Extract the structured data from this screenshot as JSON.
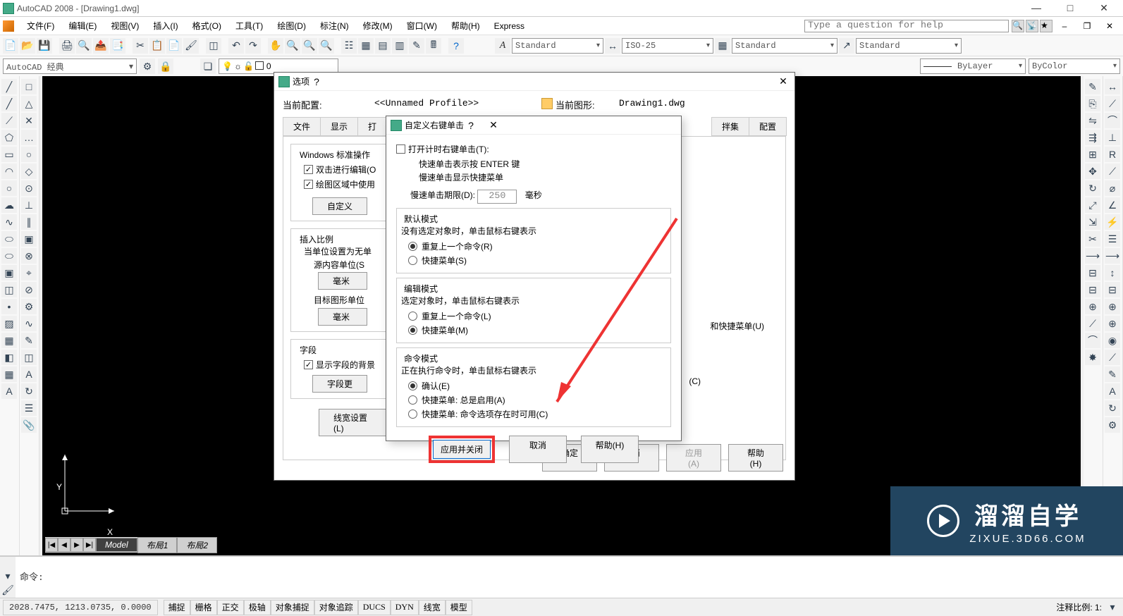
{
  "titlebar": {
    "app": "AutoCAD 2008",
    "doc": "[Drawing1.dwg]"
  },
  "winControls": {
    "min": "—",
    "max": "□",
    "close": "✕"
  },
  "menu": {
    "items": [
      "文件(F)",
      "编辑(E)",
      "视图(V)",
      "插入(I)",
      "格式(O)",
      "工具(T)",
      "绘图(D)",
      "标注(N)",
      "修改(M)",
      "窗口(W)",
      "帮助(H)",
      "Express"
    ],
    "helpPlaceholder": "Type a question for help"
  },
  "styleCombos": {
    "text": "Standard",
    "dim": "ISO-25",
    "table": "Standard",
    "ml": "Standard"
  },
  "workspace": "AutoCAD 经典",
  "properties": {
    "layer": "0",
    "linetype": "ByLayer",
    "color": "ByColor"
  },
  "layoutTabs": {
    "nav": [
      "|◀",
      "◀",
      "▶",
      "▶|"
    ],
    "model": "Model",
    "l1": "布局1",
    "l2": "布局2"
  },
  "ucs": {
    "x": "X",
    "y": "Y"
  },
  "command": {
    "prompt": "命令:"
  },
  "status": {
    "coords": "2028.7475, 1213.0735, 0.0000",
    "toggles": [
      "捕捉",
      "栅格",
      "正交",
      "极轴",
      "对象捕捉",
      "对象追踪",
      "DUCS",
      "DYN",
      "线宽",
      "模型"
    ],
    "annoScale": "注释比例: 1:"
  },
  "optionsDialog": {
    "title": "选项",
    "profileLabel": "当前配置:",
    "profileVal": "<<Unnamed Profile>>",
    "drawingLabel": "当前图形:",
    "drawingVal": "Drawing1.dwg",
    "tabs": [
      "文件",
      "显示",
      "打",
      "",
      "",
      "",
      "",
      "",
      "拌集",
      "配置"
    ],
    "group1": {
      "title": "Windows 标准操作",
      "chk1": "双击进行编辑(O",
      "chk2": "绘图区域中使用",
      "btn": "自定义"
    },
    "group2": {
      "title": "插入比例",
      "line1": "当单位设置为无单",
      "line2": "源内容单位(S",
      "val1": "毫米",
      "line3": "目标图形单位",
      "val2": "毫米"
    },
    "group3": {
      "title": "字段",
      "chk": "显示字段的背景",
      "btn": "字段更"
    },
    "rightHints": {
      "m": "和快捷菜单(U)",
      "c": "(C)"
    },
    "lineweightBtn": "线宽设置(L)",
    "buttons": {
      "ok": "确定",
      "cancel": "取消",
      "apply": "应用(A)",
      "help": "帮助(H)"
    }
  },
  "customDialog": {
    "title": "自定义右键单击",
    "timing": {
      "chk": "打开计时右键单击(T):",
      "line1": "快速单击表示按 ENTER 键",
      "line2": "慢速单击显示快捷菜单",
      "periodLabel": "慢速单击期限(D):",
      "periodVal": "250",
      "ms": "毫秒"
    },
    "default": {
      "title": "默认模式",
      "desc": "没有选定对象时，单击鼠标右键表示",
      "r1": "重复上一个命令(R)",
      "r2": "快捷菜单(S)"
    },
    "edit": {
      "title": "编辑模式",
      "desc": "选定对象时，单击鼠标右键表示",
      "r1": "重复上一个命令(L)",
      "r2": "快捷菜单(M)"
    },
    "command": {
      "title": "命令模式",
      "desc": "正在执行命令时，单击鼠标右键表示",
      "r1": "确认(E)",
      "r2": "快捷菜单: 总是启用(A)",
      "r3": "快捷菜单: 命令选项存在时可用(C)"
    },
    "buttons": {
      "apply": "应用并关闭",
      "cancel": "取消",
      "help": "帮助(H)"
    }
  },
  "watermark": {
    "main": "溜溜自学",
    "sub": "ZIXUE.3D66.COM"
  }
}
